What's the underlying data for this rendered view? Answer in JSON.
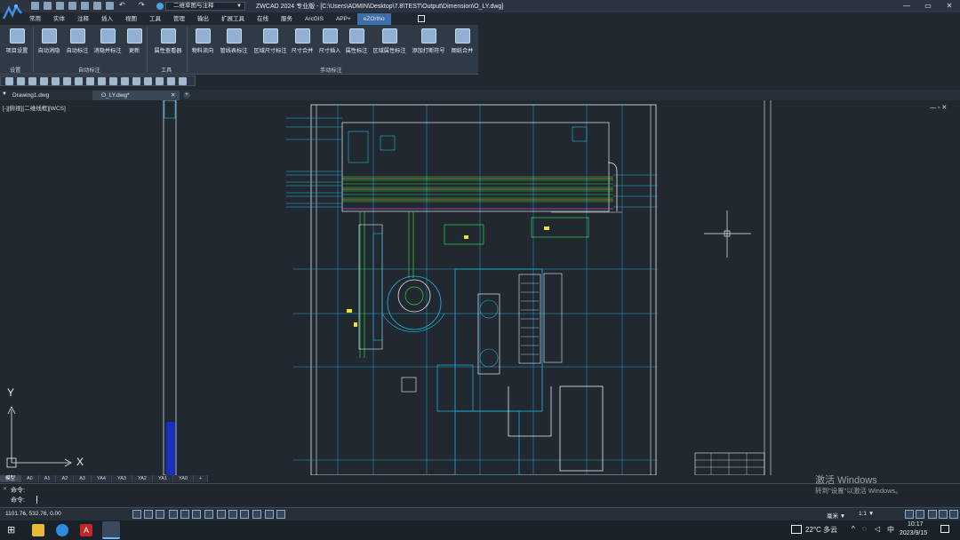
{
  "window": {
    "title": "ZWCAD 2024 专业版 - [C:\\Users\\ADMIN\\Desktop\\7.8\\TEST\\Output\\Dimension\\O_LY.dwg]",
    "workspace": "二维草图与注释",
    "minimize_icon": "minimize-icon",
    "maximize_icon": "maximize-icon",
    "close_icon": "close-icon"
  },
  "menu": [
    "常用",
    "实体",
    "注释",
    "插入",
    "视图",
    "工具",
    "管理",
    "输出",
    "扩展工具",
    "在线",
    "服务",
    "ArcGIS",
    "APP+",
    "eZOrtho"
  ],
  "menu_active": "eZOrtho",
  "ribbon": {
    "buttons": [
      {
        "label": "项目设置",
        "icon": "gear-icon"
      },
      {
        "label": "自动消隐",
        "icon": "auto-hide-icon"
      },
      {
        "label": "自动标注",
        "icon": "auto-dimension-icon"
      },
      {
        "label": "消隐并标注",
        "icon": "hide-and-dimension-icon"
      },
      {
        "label": "更新",
        "icon": "update-icon"
      },
      {
        "label": "属性查看器",
        "icon": "property-viewer-icon"
      },
      {
        "label": "物料流向",
        "icon": "material-flow-icon"
      },
      {
        "label": "管线表标注",
        "icon": "pipeline-table-icon"
      },
      {
        "label": "区域尺寸标注",
        "icon": "area-dimension-icon"
      },
      {
        "label": "尺寸合并",
        "icon": "dimension-merge-icon"
      },
      {
        "label": "尺寸插入",
        "icon": "dimension-insert-icon"
      },
      {
        "label": "属性标注",
        "icon": "attribute-label-icon"
      },
      {
        "label": "区域属性标注",
        "icon": "area-attribute-icon"
      },
      {
        "label": "添加打断符号",
        "icon": "break-symbol-icon"
      },
      {
        "label": "图纸合并",
        "icon": "drawing-merge-icon"
      }
    ],
    "groups": [
      "设置",
      "自动标注",
      "工具",
      "手动标注"
    ]
  },
  "doc_tabs": [
    {
      "label": "Drawing1.dwg"
    },
    {
      "label": "O_LY.dwg*",
      "active": true
    }
  ],
  "viewport_label": "[-][俯视][二维线框][WCS]",
  "axis": {
    "x": "X",
    "y": "Y"
  },
  "layout_tabs": [
    "模型",
    "A0",
    "A1",
    "A2",
    "A3",
    "YA4",
    "YA3",
    "YA2",
    "YA1",
    "YA0",
    "+"
  ],
  "layout_active": "模型",
  "command": {
    "line1": "命令:",
    "line2": "命令:"
  },
  "status": {
    "coords": "1101.76, 532.76, 0.00",
    "unit": "毫米",
    "scale": "1:1"
  },
  "watermark": {
    "line1": "激活 Windows",
    "line2": "转到\"设置\"以激活 Windows。"
  },
  "taskbar": {
    "weather": "22°C 多云",
    "ime": "中",
    "time": "10:17",
    "date": "2023/9/15"
  },
  "colors": {
    "accent": "#3d6fa8",
    "canvas": "#212830",
    "cyan": "#1fb8e0",
    "green": "#35d24a",
    "yellow": "#e8e23a"
  }
}
